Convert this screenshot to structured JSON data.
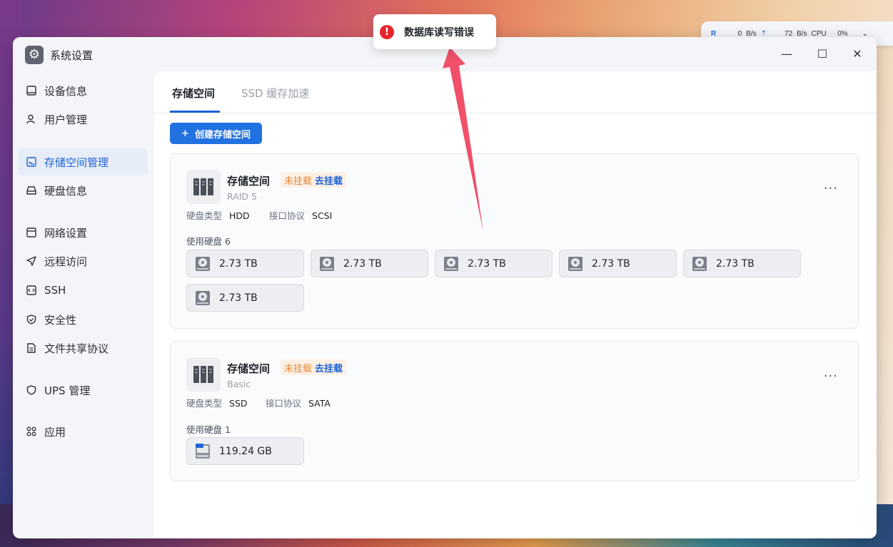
{
  "window": {
    "title": "系统设置",
    "minimize": "—",
    "maximize": "☐",
    "close": "✕"
  },
  "netbar": {
    "r_label": "R",
    "down": "0",
    "down_unit": "B/s",
    "up": "72",
    "up_unit": "B/s",
    "cpu_label": "CPU",
    "cpu": "0%"
  },
  "sidebar": {
    "items": [
      {
        "label": "设备信息",
        "icon": "device-icon"
      },
      {
        "label": "用户管理",
        "icon": "user-icon"
      },
      {
        "label": "存储空间管理",
        "icon": "storage-icon",
        "active": true
      },
      {
        "label": "硬盘信息",
        "icon": "disk-icon"
      },
      {
        "label": "网络设置",
        "icon": "network-icon"
      },
      {
        "label": "远程访问",
        "icon": "send-icon"
      },
      {
        "label": "SSH",
        "icon": "code-icon"
      },
      {
        "label": "安全性",
        "icon": "shield-check-icon"
      },
      {
        "label": "文件共享协议",
        "icon": "file-icon"
      },
      {
        "label": "UPS 管理",
        "icon": "shield-icon"
      },
      {
        "label": "应用",
        "icon": "apps-icon"
      }
    ]
  },
  "tabs": [
    "存储空间",
    "SSD 缓存加速"
  ],
  "create_button": {
    "plus": "+",
    "label": "创建存储空间"
  },
  "pools": [
    {
      "name": "存储空间",
      "status": "未挂载",
      "action": "去挂载",
      "type": "RAID 5",
      "disk_type_label": "硬盘类型",
      "disk_type": "HDD",
      "interface_label": "接口协议",
      "interface": "SCSI",
      "used_label": "使用硬盘 6",
      "more": "···",
      "disks": [
        "2.73 TB",
        "2.73 TB",
        "2.73 TB",
        "2.73 TB",
        "2.73 TB",
        "2.73 TB"
      ]
    },
    {
      "name": "存储空间",
      "status": "未挂载",
      "action": "去挂载",
      "type": "Basic",
      "disk_type_label": "硬盘类型",
      "disk_type": "SSD",
      "interface_label": "接口协议",
      "interface": "SATA",
      "used_label": "使用硬盘 1",
      "more": "···",
      "disks": [
        "119.24 GB"
      ]
    }
  ],
  "toast": {
    "icon": "!",
    "message": "数据库读写错误"
  },
  "colors": {
    "accent": "#2271e1",
    "warning": "#e68a3a",
    "error": "#e5242b"
  }
}
